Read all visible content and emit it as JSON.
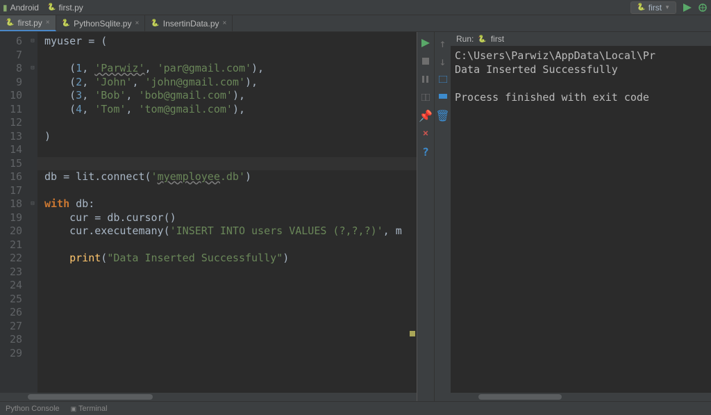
{
  "top_bar": {
    "left_items": [
      "Android",
      "first.py"
    ],
    "run_config": "first"
  },
  "tabs": [
    {
      "label": "first.py",
      "active": true
    },
    {
      "label": "PythonSqlite.py",
      "active": false
    },
    {
      "label": "InsertinData.py",
      "active": false
    }
  ],
  "editor": {
    "line_start": 6,
    "lines": [
      {
        "n": 6,
        "tokens": [
          {
            "t": "myuser ",
            "c": "var"
          },
          {
            "t": "= ",
            "c": "var"
          },
          {
            "t": "(",
            "c": "var"
          }
        ]
      },
      {
        "n": 7,
        "tokens": []
      },
      {
        "n": 8,
        "tokens": [
          {
            "t": "    (",
            "c": "var"
          },
          {
            "t": "1",
            "c": "num"
          },
          {
            "t": ", ",
            "c": "var"
          },
          {
            "t": "'Parwiz'",
            "c": "str",
            "u": true
          },
          {
            "t": ", ",
            "c": "var"
          },
          {
            "t": "'par@gmail.com'",
            "c": "str"
          },
          {
            "t": "),",
            "c": "var"
          }
        ]
      },
      {
        "n": 9,
        "tokens": [
          {
            "t": "    (",
            "c": "var"
          },
          {
            "t": "2",
            "c": "num"
          },
          {
            "t": ", ",
            "c": "var"
          },
          {
            "t": "'John'",
            "c": "str"
          },
          {
            "t": ", ",
            "c": "var"
          },
          {
            "t": "'john@gmail.com'",
            "c": "str"
          },
          {
            "t": "),",
            "c": "var"
          }
        ]
      },
      {
        "n": 10,
        "tokens": [
          {
            "t": "    (",
            "c": "var"
          },
          {
            "t": "3",
            "c": "num"
          },
          {
            "t": ", ",
            "c": "var"
          },
          {
            "t": "'Bob'",
            "c": "str"
          },
          {
            "t": ", ",
            "c": "var"
          },
          {
            "t": "'bob@gmail.com'",
            "c": "str"
          },
          {
            "t": "),",
            "c": "var"
          }
        ]
      },
      {
        "n": 11,
        "tokens": [
          {
            "t": "    (",
            "c": "var"
          },
          {
            "t": "4",
            "c": "num"
          },
          {
            "t": ", ",
            "c": "var"
          },
          {
            "t": "'Tom'",
            "c": "str"
          },
          {
            "t": ", ",
            "c": "var"
          },
          {
            "t": "'tom@gmail.com'",
            "c": "str"
          },
          {
            "t": "),",
            "c": "var"
          }
        ]
      },
      {
        "n": 12,
        "tokens": []
      },
      {
        "n": 13,
        "tokens": [
          {
            "t": ")",
            "c": "var"
          }
        ]
      },
      {
        "n": 14,
        "tokens": []
      },
      {
        "n": 15,
        "tokens": [],
        "hl": true
      },
      {
        "n": 16,
        "tokens": [
          {
            "t": "db ",
            "c": "var"
          },
          {
            "t": "= ",
            "c": "var"
          },
          {
            "t": "lit.connect(",
            "c": "var"
          },
          {
            "t": "'",
            "c": "str"
          },
          {
            "t": "myemployee",
            "c": "str",
            "u": true
          },
          {
            "t": ".db'",
            "c": "str"
          },
          {
            "t": ")",
            "c": "var"
          }
        ]
      },
      {
        "n": 17,
        "tokens": []
      },
      {
        "n": 18,
        "tokens": [
          {
            "t": "with ",
            "c": "kw"
          },
          {
            "t": "db:",
            "c": "var"
          }
        ]
      },
      {
        "n": 19,
        "tokens": [
          {
            "t": "    cur ",
            "c": "var"
          },
          {
            "t": "= ",
            "c": "var"
          },
          {
            "t": "db.cursor()",
            "c": "var"
          }
        ]
      },
      {
        "n": 20,
        "tokens": [
          {
            "t": "    cur.executemany(",
            "c": "var"
          },
          {
            "t": "'INSERT INTO users VALUES (?,?,?)'",
            "c": "str"
          },
          {
            "t": ", m",
            "c": "var"
          }
        ]
      },
      {
        "n": 21,
        "tokens": []
      },
      {
        "n": 22,
        "tokens": [
          {
            "t": "    ",
            "c": "var"
          },
          {
            "t": "print",
            "c": "fn"
          },
          {
            "t": "(",
            "c": "var"
          },
          {
            "t": "\"Data Inserted Successfully\"",
            "c": "str"
          },
          {
            "t": ")",
            "c": "var"
          }
        ]
      },
      {
        "n": 23,
        "tokens": []
      },
      {
        "n": 24,
        "tokens": []
      },
      {
        "n": 25,
        "tokens": []
      },
      {
        "n": 26,
        "tokens": []
      },
      {
        "n": 27,
        "tokens": []
      },
      {
        "n": 28,
        "tokens": []
      },
      {
        "n": 29,
        "tokens": []
      }
    ]
  },
  "run_panel": {
    "header": "Run:",
    "config": "first",
    "output": "C:\\Users\\Parwiz\\AppData\\Local\\Pr\nData Inserted Successfully\n\nProcess finished with exit code "
  },
  "bottom_bar": {
    "items": [
      "Python Console",
      "Terminal"
    ]
  }
}
